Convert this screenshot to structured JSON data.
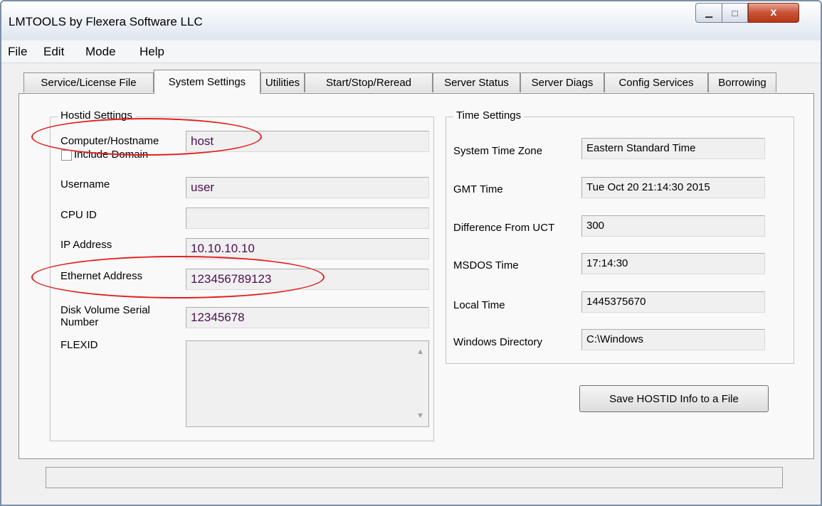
{
  "window": {
    "title": "LMTOOLS by Flexera Software LLC",
    "close_glyph": "x",
    "max_glyph": "□",
    "min_glyph": "▁"
  },
  "menu": [
    "File",
    "Edit",
    "Mode",
    "Help"
  ],
  "tabs": [
    {
      "label": "Service/License File",
      "active": false
    },
    {
      "label": "System Settings",
      "active": true
    },
    {
      "label": "Utilities",
      "active": false
    },
    {
      "label": "Start/Stop/Reread",
      "active": false
    },
    {
      "label": "Server Status",
      "active": false
    },
    {
      "label": "Server Diags",
      "active": false
    },
    {
      "label": "Config Services",
      "active": false
    },
    {
      "label": "Borrowing",
      "active": false
    }
  ],
  "hostid": {
    "title": "Hostid Settings",
    "hostname_label": "Computer/Hostname",
    "hostname_value": "host",
    "include_domain_label": "Include Domain",
    "username_label": "Username",
    "username_value": "user",
    "cpuid_label": "CPU ID",
    "cpuid_value": "",
    "ip_label": "IP Address",
    "ip_value": "10.10.10.10",
    "ethernet_label": "Ethernet Address",
    "ethernet_value": "123456789123",
    "disk_label_line1": "Disk Volume Serial",
    "disk_label_line2": "Number",
    "disk_value": "12345678",
    "flexid_label": "FLEXID"
  },
  "time": {
    "title": "Time Settings",
    "timezone_label": "System Time Zone",
    "timezone_value": "Eastern Standard Time",
    "gmt_label": "GMT Time",
    "gmt_value": "Tue Oct 20 21:14:30 2015",
    "diff_label": "Difference From UCT",
    "diff_value": "300",
    "msdos_label": "MSDOS Time",
    "msdos_value": "17:14:30",
    "local_label": "Local Time",
    "local_value": "1445375670",
    "windir_label": "Windows Directory",
    "windir_value": "C:\\Windows"
  },
  "save_button_label": "Save HOSTID Info to a File",
  "status_text": "",
  "annotation_color": "#e0201e"
}
